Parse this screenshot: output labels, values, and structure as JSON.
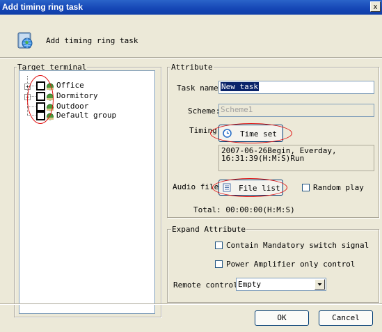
{
  "window": {
    "title": "Add timing ring task",
    "close_glyph": "x"
  },
  "header": {
    "text": "Add timing ring task",
    "icon": "speaker-globe-icon"
  },
  "target_terminal": {
    "legend": "Target terminal",
    "nodes": [
      {
        "label": "Office",
        "expandable": true,
        "checked": false
      },
      {
        "label": "Dormitory",
        "expandable": true,
        "checked": false
      },
      {
        "label": "Outdoor",
        "expandable": false,
        "checked": false
      },
      {
        "label": "Default group",
        "expandable": false,
        "checked": false
      }
    ]
  },
  "attribute": {
    "legend": "Attribute",
    "task_name_label": "Task name:",
    "task_name_value": "New task",
    "scheme_label": "Scheme:",
    "scheme_value": "Scheme1",
    "timing_label": "Timing:",
    "time_set_button": "Time set",
    "timing_info_line1": "2007-06-26Begin, Everday,",
    "timing_info_line2": "16:31:39(H:M:S)Run",
    "audio_file_label": "Audio file:",
    "file_list_button": "File list",
    "random_play_label": "Random play",
    "random_play_checked": false,
    "total_text": "Total: 00:00:00(H:M:S)"
  },
  "expand_attribute": {
    "legend": "Expand Attribute",
    "contain_mandatory_label": "Contain Mandatory switch signal",
    "contain_mandatory_checked": false,
    "power_amplifier_label": "Power Amplifier only control",
    "power_amplifier_checked": false,
    "remote_control_label": "Remote control:",
    "remote_control_value": "Empty"
  },
  "buttons": {
    "ok": "OK",
    "cancel": "Cancel"
  },
  "annotation_color": "#e01010"
}
